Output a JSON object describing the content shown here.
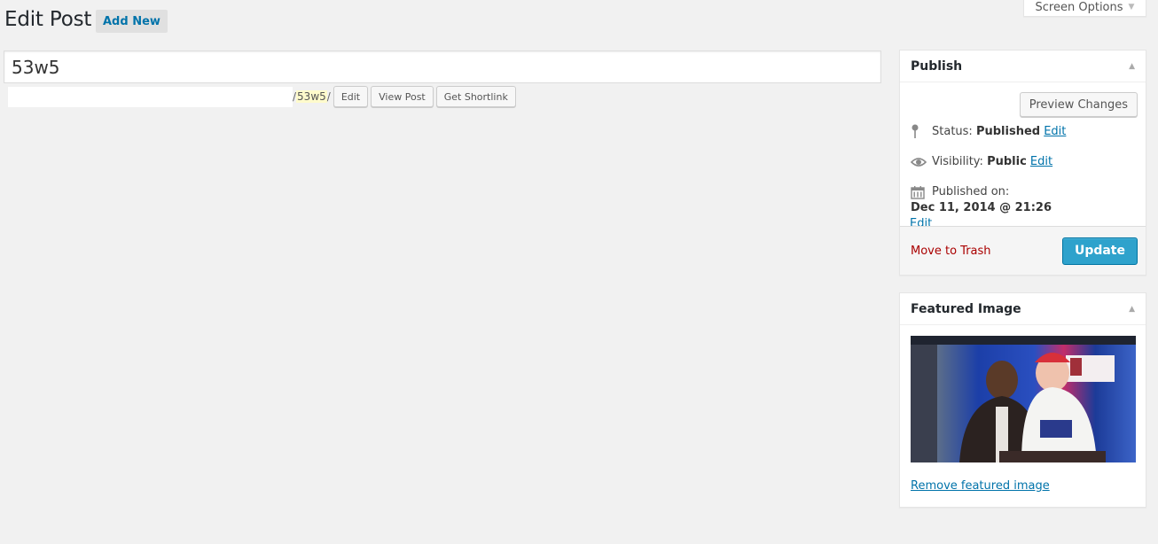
{
  "header": {
    "title": "Edit Post",
    "add_new_label": "Add New",
    "screen_options_label": "Screen Options"
  },
  "post": {
    "title": "53w5",
    "permalink": {
      "prefix": "/",
      "slug": "53w5",
      "suffix": "/",
      "edit_label": "Edit",
      "view_post_label": "View Post",
      "shortlink_label": "Get Shortlink"
    }
  },
  "publish_box": {
    "heading": "Publish",
    "preview_label": "Preview Changes",
    "status_label": "Status:",
    "status_value": "Published",
    "visibility_label": "Visibility:",
    "visibility_value": "Public",
    "published_on_label": "Published on:",
    "published_on_value": "Dec 11, 2014 @ 21:26",
    "edit_label": "Edit",
    "trash_label": "Move to Trash",
    "update_label": "Update",
    "icons": {
      "status": "pin-icon",
      "visibility": "eye-icon",
      "date": "calendar-icon"
    }
  },
  "featured_image_box": {
    "heading": "Featured Image",
    "image_alt": "Two men posing at a Taste of the Giants event",
    "remove_label": "Remove featured image"
  },
  "colors": {
    "link": "#0073aa",
    "trash": "#a00",
    "primary_button": "#2ea2cc",
    "slug_highlight": "#fffbcc"
  }
}
